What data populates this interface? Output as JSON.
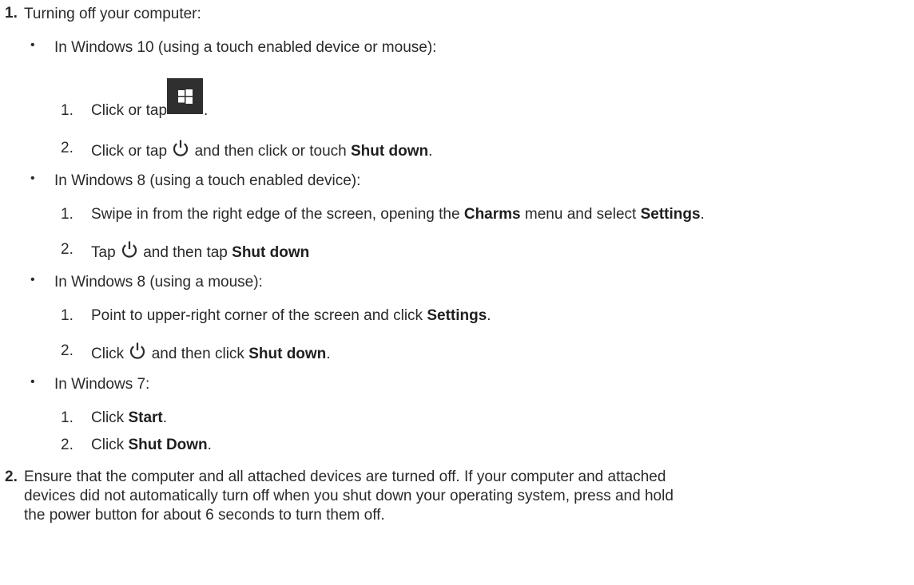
{
  "step1": {
    "number": "1.",
    "title": "Turning off your computer:",
    "win10": {
      "bullet": "In Windows 10 (using a touch enabled device or mouse):",
      "s1": {
        "num": "1.",
        "pre": "Click or tap",
        "post": "."
      },
      "s2": {
        "num": "2.",
        "pre": "Click or tap",
        "mid": "and then click or touch",
        "bold": "Shut down",
        "post": "."
      }
    },
    "win8touch": {
      "bullet": "In Windows 8 (using a touch enabled device):",
      "s1": {
        "num": "1.",
        "pre": "Swipe in from the right edge of the screen, opening the",
        "bold1": "Charms",
        "mid": "menu and select",
        "bold2": "Settings",
        "post": "."
      },
      "s2": {
        "num": "2.",
        "pre": "Tap",
        "mid": "and then tap",
        "bold": "Shut down"
      }
    },
    "win8mouse": {
      "bullet": "In Windows 8 (using a mouse):",
      "s1": {
        "num": "1.",
        "pre": "Point to upper-right corner of the screen and click",
        "bold": "Settings",
        "post": "."
      },
      "s2": {
        "num": "2.",
        "pre": "Click",
        "mid": "and then click",
        "bold": "Shut down",
        "post": "."
      }
    },
    "win7": {
      "bullet": "In Windows 7:",
      "s1": {
        "num": "1.",
        "pre": "Click",
        "bold": "Start",
        "post": "."
      },
      "s2": {
        "num": "2.",
        "pre": "Click",
        "bold": "Shut Down",
        "post": "."
      }
    }
  },
  "step2": {
    "number": "2.",
    "lines": [
      "Ensure that the computer and all attached devices are turned off. If your computer and attached",
      "devices did not automatically turn off when you shut down your operating system, press and hold",
      "the power button for about 6 seconds to turn them off."
    ]
  },
  "icons": {
    "windows": "windows-logo-icon",
    "power": "power-icon"
  },
  "colors": {
    "text": "#2a2a2a",
    "tile": "#2f2f2f"
  }
}
